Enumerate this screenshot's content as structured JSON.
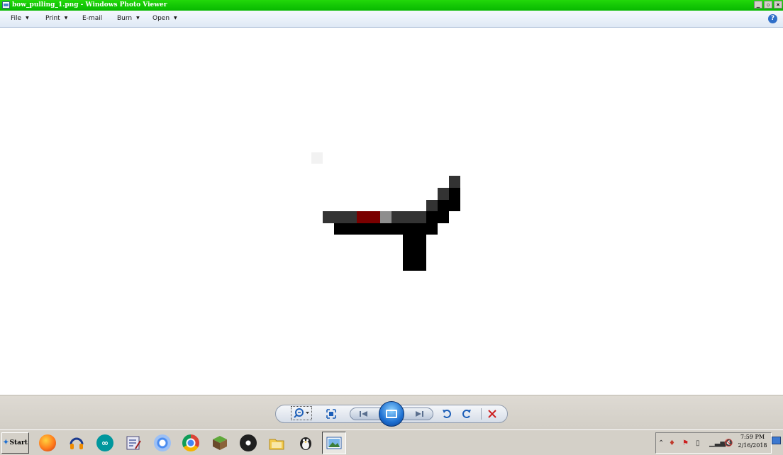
{
  "window": {
    "title": "bow_pulling_1.png - Windows Photo Viewer",
    "controls": [
      "minimize",
      "restore",
      "close"
    ]
  },
  "menu": {
    "file": "File",
    "print": "Print",
    "email": "E-mail",
    "burn": "Burn",
    "open": "Open",
    "help_icon": "help-icon"
  },
  "controls": {
    "zoom": "zoom-icon",
    "actual_size": "fit-window-icon",
    "previous": "previous-icon",
    "slideshow": "slideshow-icon",
    "next": "next-icon",
    "rotate_ccw": "rotate-counterclockwise-icon",
    "rotate_cw": "rotate-clockwise-icon",
    "delete": "delete-icon",
    "accent": "#1d6fd1",
    "delete_color": "#cc1f1f"
  },
  "taskbar": {
    "start_label": "Start",
    "apps": [
      "firefox-icon",
      "audacity-icon",
      "arduino-icon",
      "editor-icon",
      "chromium-icon",
      "chrome-icon",
      "minecraft-icon",
      "obs-icon",
      "file-manager-icon",
      "linux-penguin-icon",
      "photo-viewer-icon"
    ],
    "active_app": "photo-viewer-icon",
    "tray_icons": [
      "show-hidden-icons-icon",
      "app-tray-icon",
      "flag-error-icon",
      "battery-icon",
      "network-signal-icon",
      "volume-muted-icon"
    ],
    "time": "7:59 PM",
    "date": "2/16/2018"
  },
  "image": {
    "colors": {
      "dark_gray": "#333333",
      "black": "#000000",
      "dark_red": "#7a0000",
      "light_gray": "#8e8e8e",
      "faint": "#f2f2f2"
    }
  }
}
